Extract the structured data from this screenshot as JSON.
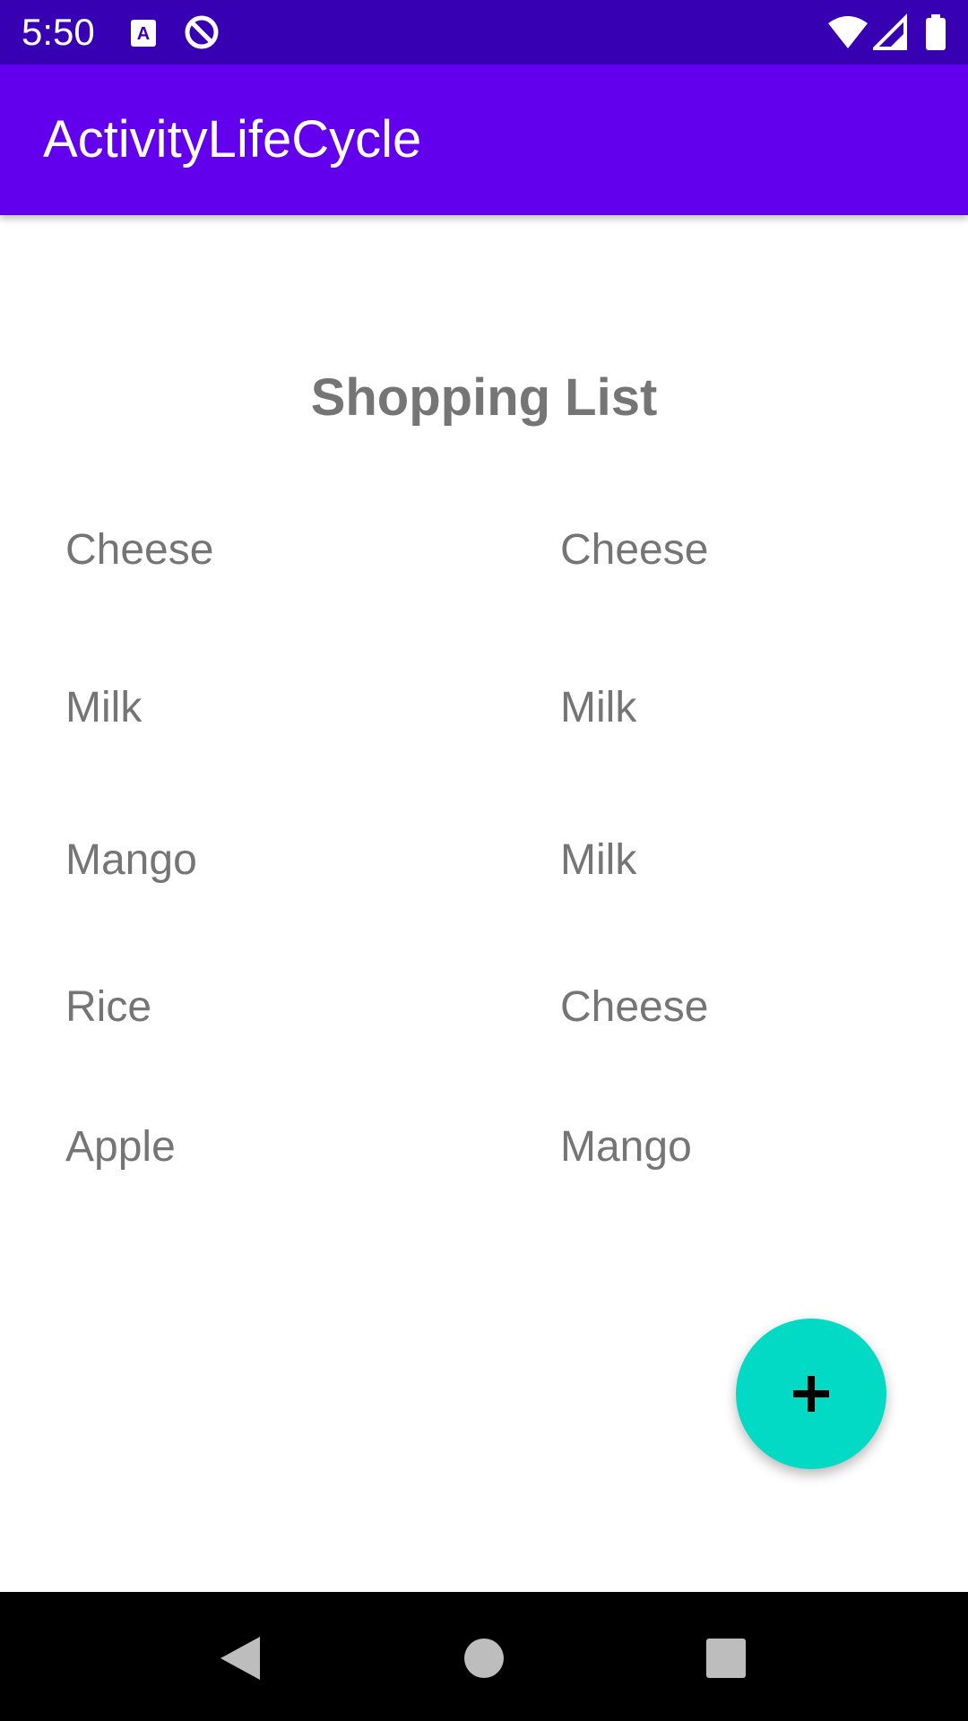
{
  "status_bar": {
    "time": "5:50",
    "icons": [
      "a-notification-icon",
      "data-saver-icon",
      "wifi-icon",
      "signal-icon",
      "battery-icon"
    ]
  },
  "app_bar": {
    "title": "ActivityLifeCycle"
  },
  "main": {
    "title": "Shopping List",
    "left_items": [
      "Cheese",
      "Milk",
      "Mango",
      "Rice",
      "Apple"
    ],
    "right_items": [
      "Cheese",
      "Milk",
      "Milk",
      "Cheese",
      "Mango"
    ]
  },
  "fab": {
    "icon": "plus-icon"
  },
  "nav_bar": {
    "icons": [
      "back-icon",
      "home-icon",
      "recents-icon"
    ]
  },
  "colors": {
    "status_bar": "#3700b3",
    "app_bar": "#6200ee",
    "fab": "#03dac5",
    "text": "#757575"
  }
}
